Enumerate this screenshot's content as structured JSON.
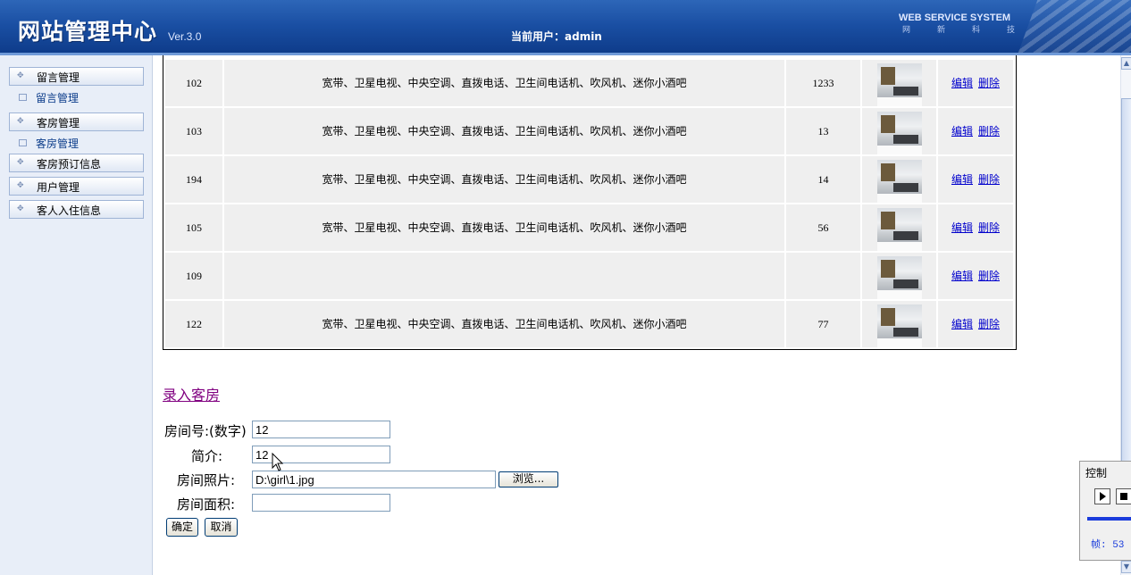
{
  "header": {
    "title": "网站管理中心",
    "version": "Ver.3.0",
    "current_user": "当前用户：admin",
    "brand": "WEB SERVICE SYSTEM",
    "brand_sub": "网新科技"
  },
  "sidebar": {
    "items": [
      {
        "label": "留言管理",
        "type": "header"
      },
      {
        "label": "留言管理",
        "type": "sub"
      },
      {
        "label": "客房管理",
        "type": "header"
      },
      {
        "label": "客房管理",
        "type": "sub"
      },
      {
        "label": "客房预订信息",
        "type": "header"
      },
      {
        "label": "用户管理",
        "type": "header"
      },
      {
        "label": "客人入住信息",
        "type": "header"
      }
    ]
  },
  "rooms": {
    "rows": [
      {
        "no": "102",
        "desc": "宽带、卫星电视、中央空调、直拨电话、卫生间电话机、吹风机、迷你小酒吧",
        "area": "1233"
      },
      {
        "no": "103",
        "desc": "宽带、卫星电视、中央空调、直拨电话、卫生间电话机、吹风机、迷你小酒吧",
        "area": "13"
      },
      {
        "no": "194",
        "desc": "宽带、卫星电视、中央空调、直拨电话、卫生间电话机、吹风机、迷你小酒吧",
        "area": "14"
      },
      {
        "no": "105",
        "desc": "宽带、卫星电视、中央空调、直拨电话、卫生间电话机、吹风机、迷你小酒吧",
        "area": "56"
      },
      {
        "no": "109",
        "desc": "",
        "area": ""
      },
      {
        "no": "122",
        "desc": "宽带、卫星电视、中央空调、直拨电话、卫生间电话机、吹风机、迷你小酒吧",
        "area": "77"
      }
    ],
    "edit_label": "编辑",
    "delete_label": "删除"
  },
  "form": {
    "add_link": "录入客房",
    "room_no_label": "房间号:(数字)",
    "room_no_value": "12",
    "intro_label": "简介:",
    "intro_value": "12",
    "photo_label": "房间照片:",
    "photo_value": "D:\\girl\\1.jpg",
    "browse_label": "浏览...",
    "area_label": "房间面积:",
    "area_value": "",
    "ok_label": "确定",
    "cancel_label": "取消"
  },
  "control": {
    "title": "控制",
    "frame_label": "帧: 53"
  }
}
